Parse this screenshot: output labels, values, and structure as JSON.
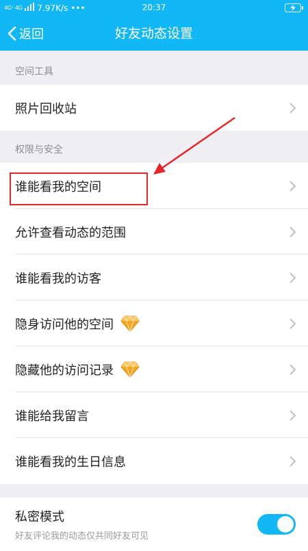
{
  "status_bar": {
    "network": "4G⁺ 4G",
    "speed": "7.97K/s",
    "dots": "•••",
    "time": "20:37"
  },
  "nav": {
    "back_label": "返回",
    "title": "好友动态设置"
  },
  "sections": [
    {
      "header": "空间工具",
      "items": [
        {
          "label": "照片回收站",
          "vip": false
        }
      ]
    },
    {
      "header": "权限与安全",
      "items": [
        {
          "label": "谁能看我的空间",
          "vip": false,
          "highlighted": true
        },
        {
          "label": "允许查看动态的范围",
          "vip": false
        },
        {
          "label": "谁能看我的访客",
          "vip": false
        },
        {
          "label": "隐身访问他的空间",
          "vip": true
        },
        {
          "label": "隐藏他的访问记录",
          "vip": true
        },
        {
          "label": "谁能给我留言",
          "vip": false
        },
        {
          "label": "谁能看我的生日信息",
          "vip": false
        }
      ]
    }
  ],
  "private_mode": {
    "label": "私密模式",
    "description": "好友评论我的动态仅共同好友可见",
    "enabled": true
  },
  "colors": {
    "brand": "#12b7f5",
    "annotation": "#e5262b",
    "diamond": "#f5a623"
  }
}
